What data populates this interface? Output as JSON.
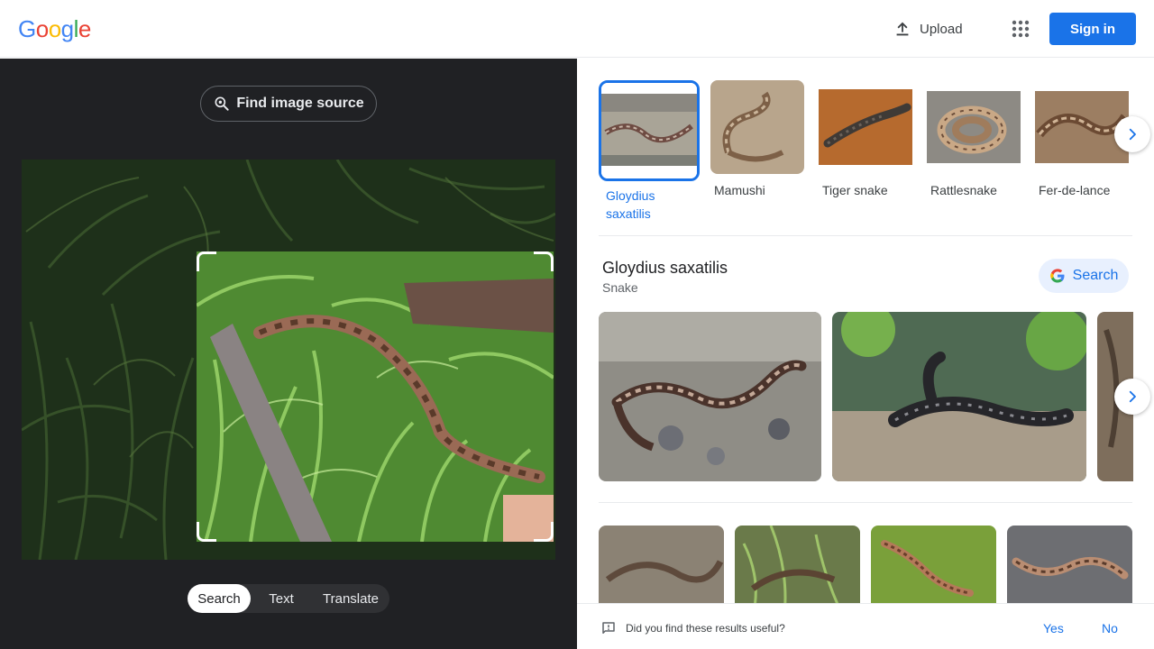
{
  "header": {
    "logo_letters": [
      "G",
      "o",
      "o",
      "g",
      "l",
      "e"
    ],
    "logo_colors": [
      "#4285F4",
      "#EA4335",
      "#FBBC05",
      "#4285F4",
      "#34A853",
      "#EA4335"
    ],
    "upload_label": "Upload",
    "signin_label": "Sign in"
  },
  "left_panel": {
    "find_source_label": "Find image source",
    "mode_tabs": [
      {
        "label": "Search",
        "active": true
      },
      {
        "label": "Text",
        "active": false
      },
      {
        "label": "Translate",
        "active": false
      }
    ]
  },
  "related_chips": [
    {
      "label": "Gloydius saxatilis",
      "selected": true
    },
    {
      "label": "Mamushi",
      "selected": false
    },
    {
      "label": "Tiger snake",
      "selected": false
    },
    {
      "label": "Rattlesnake",
      "selected": false
    },
    {
      "label": "Fer-de-lance",
      "selected": false
    }
  ],
  "entity": {
    "title": "Gloydius saxatilis",
    "subtitle": "Snake",
    "search_label": "Search"
  },
  "feedback": {
    "question": "Did you find these results useful?",
    "yes_label": "Yes",
    "no_label": "No"
  },
  "colors": {
    "accent": "#1a73e8",
    "dark_panel": "#202124"
  }
}
